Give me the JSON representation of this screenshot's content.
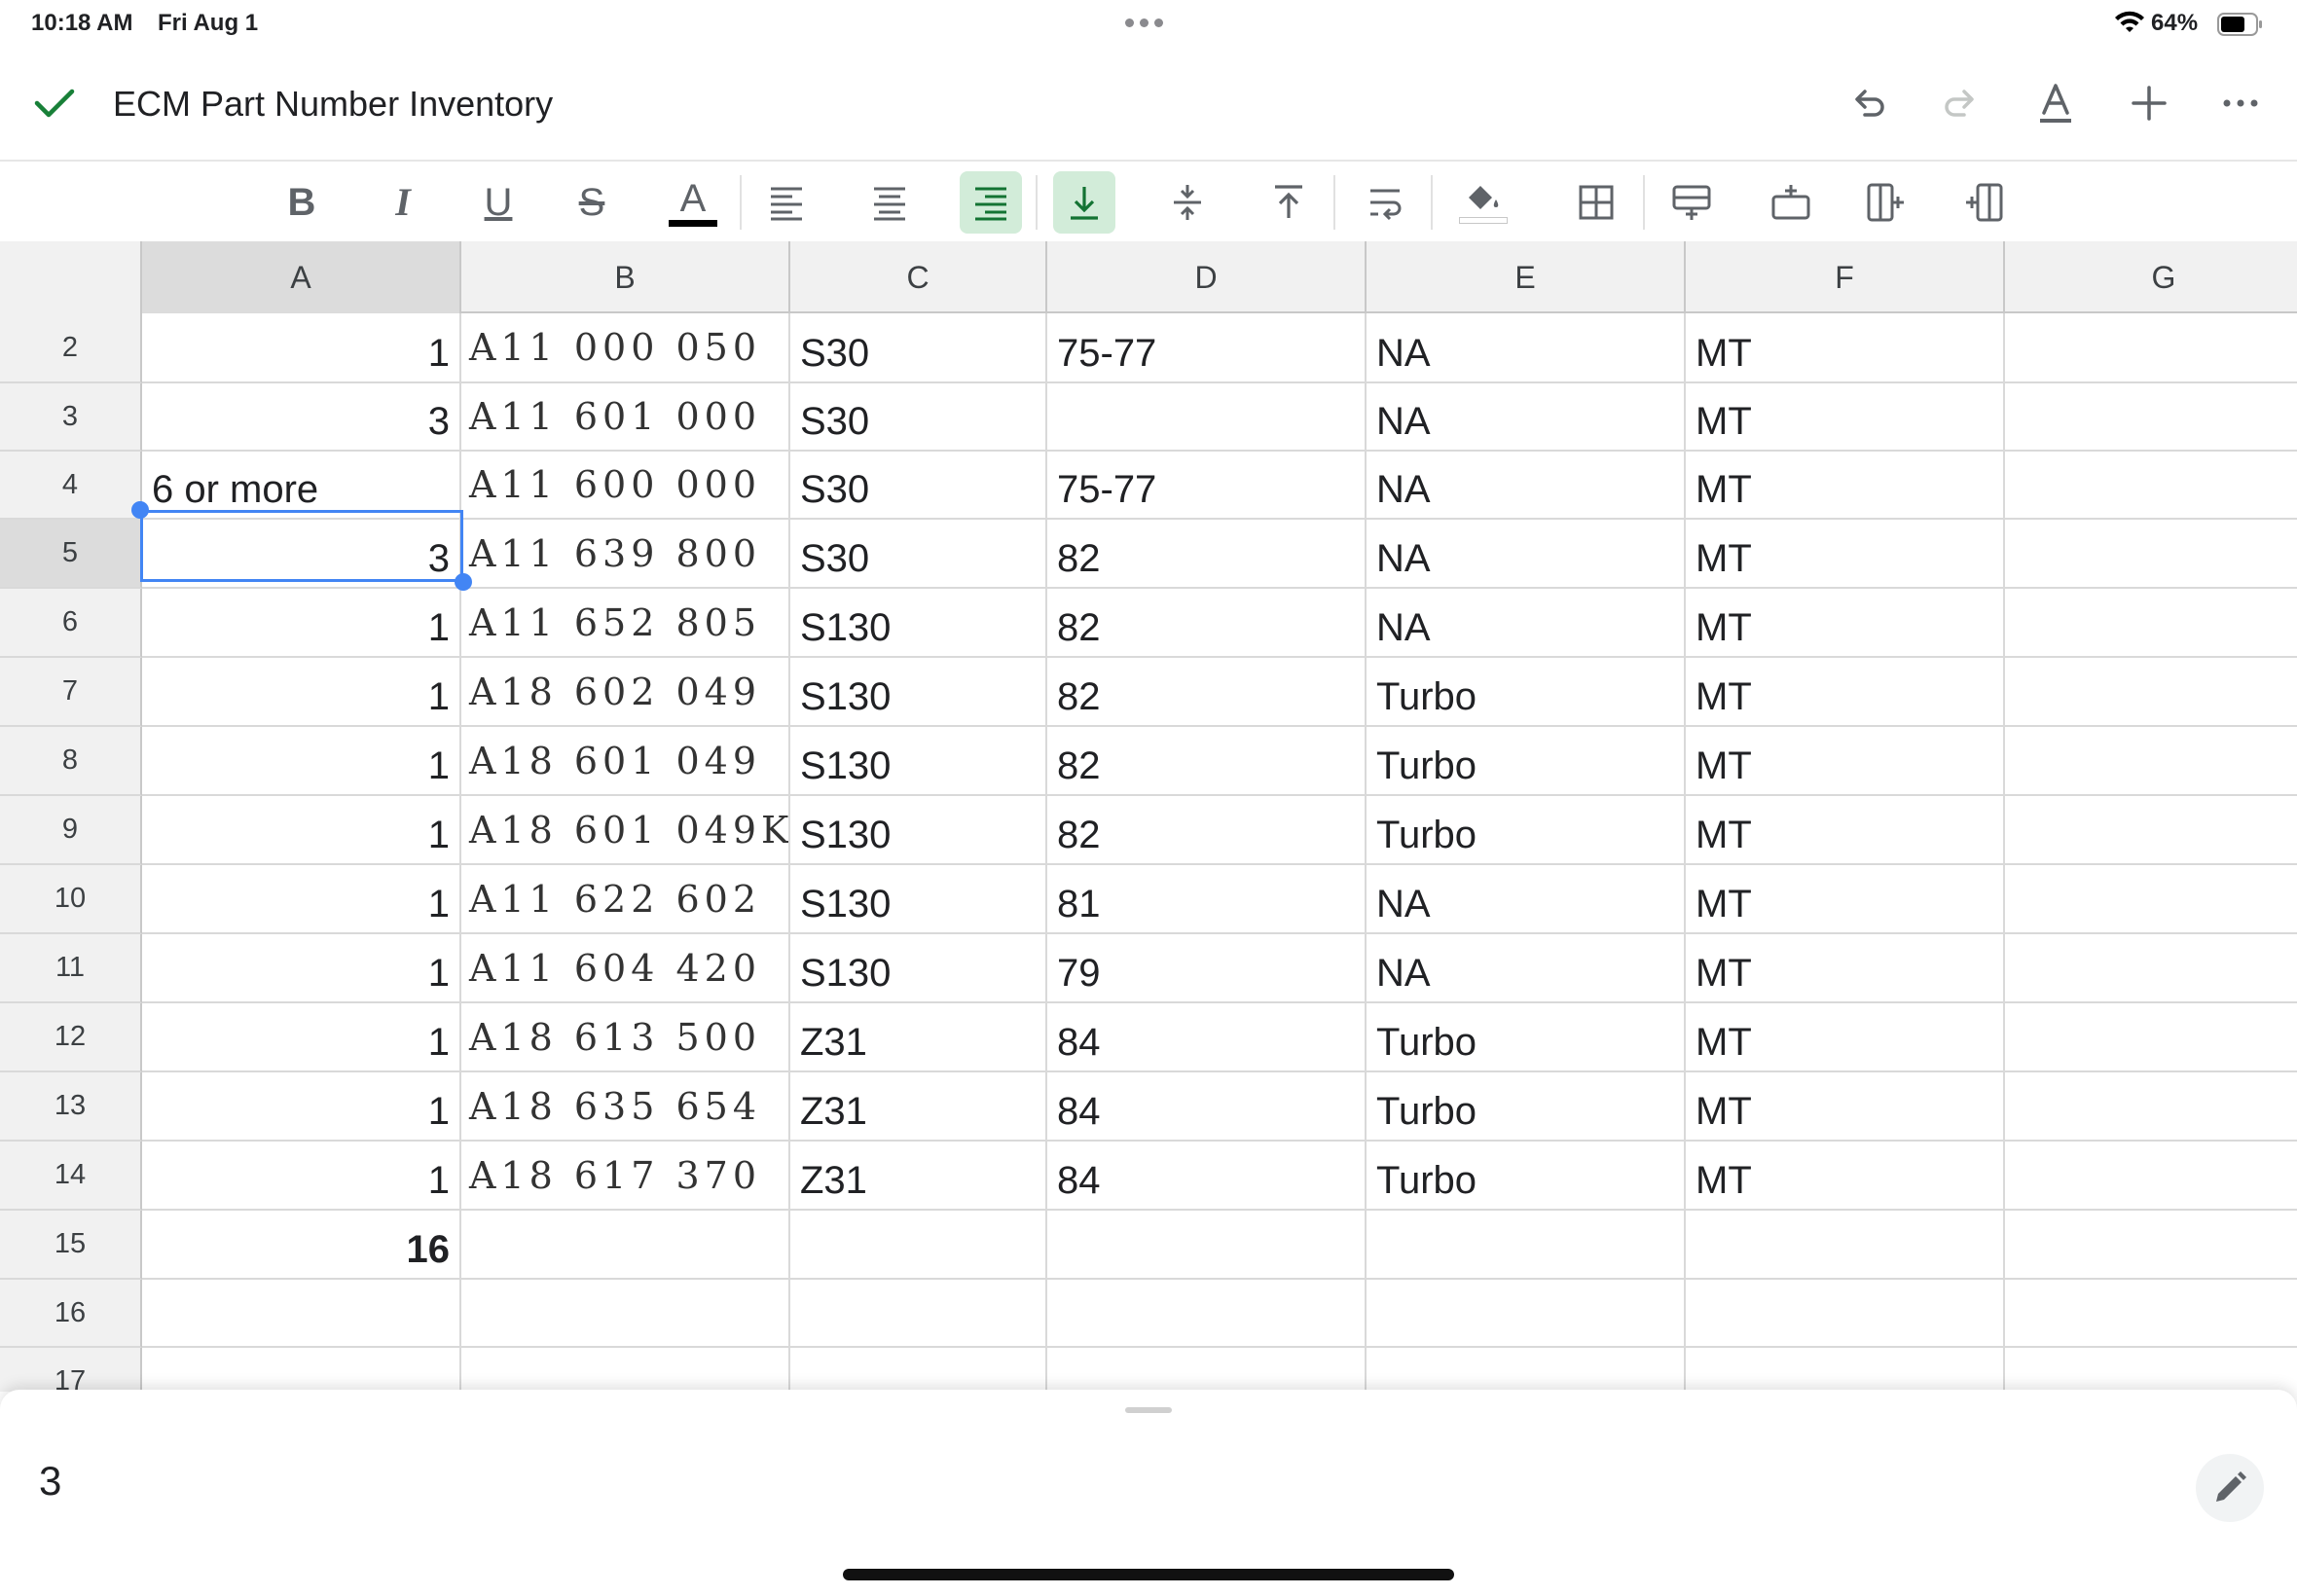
{
  "status_bar": {
    "time": "10:18 AM",
    "date": "Fri Aug 1",
    "battery": "64%"
  },
  "titlebar": {
    "title": "ECM Part Number Inventory",
    "accent_color": "#188038"
  },
  "toolbar_icons": [
    "bold-icon",
    "italic-icon",
    "underline-icon",
    "strikethrough-icon",
    "text-color-icon",
    "align-left-icon",
    "align-center-icon",
    "align-right-icon",
    "valign-bottom-icon",
    "valign-middle-icon",
    "valign-top-icon",
    "wrap-text-icon",
    "fill-color-icon",
    "borders-icon",
    "insert-row-above-icon",
    "insert-row-below-icon",
    "insert-column-left-icon",
    "insert-column-right-icon"
  ],
  "format": {
    "bold": "B",
    "italic": "I",
    "underline": "U",
    "strike": "S",
    "text_color": "A"
  },
  "columns": [
    "A",
    "B",
    "C",
    "D",
    "E",
    "F",
    "G"
  ],
  "selected": {
    "cell": "A5",
    "column": "A",
    "row": "5"
  },
  "rows": [
    {
      "num": "2",
      "a": "1",
      "b": "A11 000 050",
      "c": "S30",
      "d": "75-77",
      "e": "NA",
      "f": "MT"
    },
    {
      "num": "3",
      "a": "3",
      "b": "A11 601 000",
      "c": "S30",
      "d": "",
      "e": "NA",
      "f": "MT"
    },
    {
      "num": "4",
      "a": "6 or more",
      "b": "A11 600 000",
      "c": "S30",
      "d": "75-77",
      "e": "NA",
      "f": "MT"
    },
    {
      "num": "5",
      "a": "3",
      "b": "A11 639 800",
      "c": "S30",
      "d": "82",
      "e": "NA",
      "f": "MT"
    },
    {
      "num": "6",
      "a": "1",
      "b": "A11 652 805",
      "c": "S130",
      "d": "82",
      "e": "NA",
      "f": "MT"
    },
    {
      "num": "7",
      "a": "1",
      "b": "A18 602 049",
      "c": "S130",
      "d": "82",
      "e": "Turbo",
      "f": "MT"
    },
    {
      "num": "8",
      "a": "1",
      "b": "A18 601 049",
      "c": "S130",
      "d": "82",
      "e": "Turbo",
      "f": "MT"
    },
    {
      "num": "9",
      "a": "1",
      "b": "A18 601 049K",
      "c": "S130",
      "d": "82",
      "e": "Turbo",
      "f": "MT"
    },
    {
      "num": "10",
      "a": "1",
      "b": "A11 622 602",
      "c": "S130",
      "d": "81",
      "e": "NA",
      "f": "MT"
    },
    {
      "num": "11",
      "a": "1",
      "b": "A11 604 420",
      "c": "S130",
      "d": "79",
      "e": "NA",
      "f": "MT"
    },
    {
      "num": "12",
      "a": "1",
      "b": "A18 613 500",
      "c": "Z31",
      "d": "84",
      "e": "Turbo",
      "f": "MT"
    },
    {
      "num": "13",
      "a": "1",
      "b": "A18 635 654",
      "c": "Z31",
      "d": "84",
      "e": "Turbo",
      "f": "MT"
    },
    {
      "num": "14",
      "a": "1",
      "b": "A18 617 370",
      "c": "Z31",
      "d": "84",
      "e": "Turbo",
      "f": "MT"
    },
    {
      "num": "15",
      "a": "16",
      "b": "",
      "c": "",
      "d": "",
      "e": "",
      "f": ""
    },
    {
      "num": "16",
      "a": "",
      "b": "",
      "c": "",
      "d": "",
      "e": "",
      "f": ""
    },
    {
      "num": "17",
      "a": "",
      "b": "",
      "c": "",
      "d": "",
      "e": "",
      "f": ""
    }
  ],
  "formula_bar": {
    "value": "3"
  }
}
